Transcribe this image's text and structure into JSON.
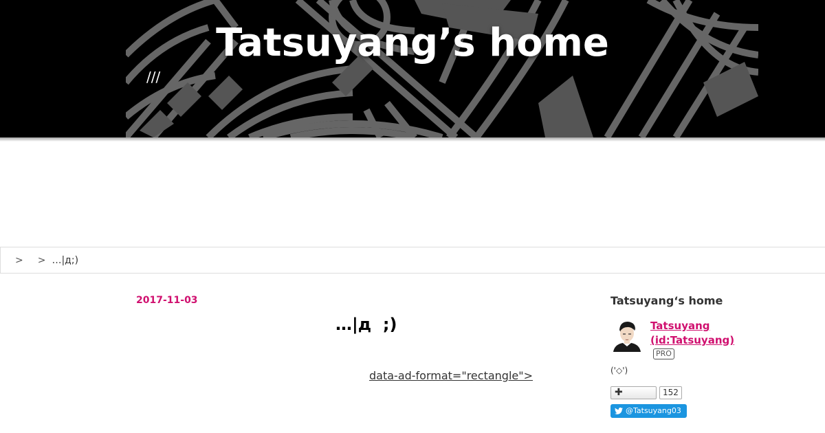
{
  "header": {
    "title": "Tatsuyang’s home",
    "description": "///"
  },
  "breadcrumb": {
    "links": [
      "",
      ""
    ],
    "separator": ">",
    "current": "…|д;)"
  },
  "entry": {
    "date": "2017-11-03",
    "title": "…|д  ;)",
    "ad_text": "data-ad-format=\"rectangle\">"
  },
  "sidebar": {
    "title": "Tatsuyang‘s home",
    "profile": {
      "name": "Tatsuyang (id:Tatsuyang)",
      "badge": "PRO",
      "description": "('◇')"
    },
    "follow": {
      "label": "✚",
      "count": "152"
    },
    "twitter": {
      "label": "@Tatsuyang03",
      "icon": "twitter-bird-icon"
    }
  },
  "colors": {
    "accent": "#d0106f",
    "header_bg": "#000000",
    "twitter": "#1b95e0"
  }
}
